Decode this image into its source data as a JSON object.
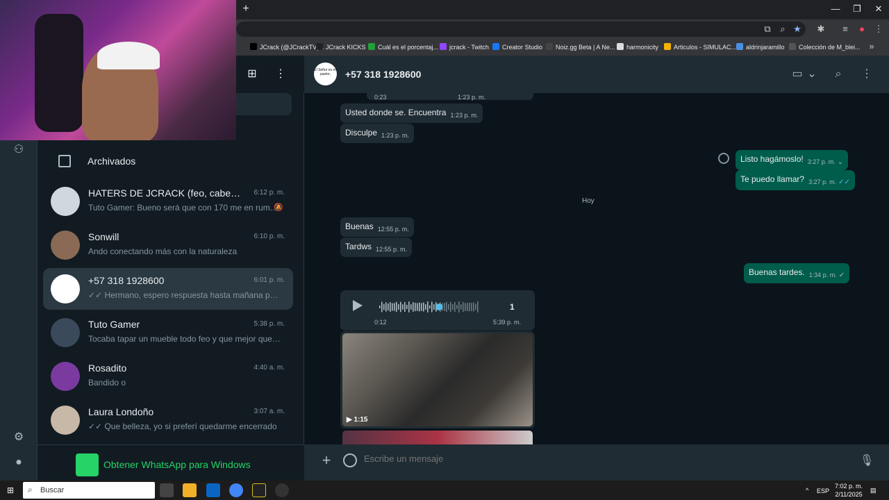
{
  "browser": {
    "new_tab_symbol": "+",
    "bookmarks": [
      {
        "label": "JCrack (@JCrackTV)...",
        "color": "#000000"
      },
      {
        "label": "JCrack KICKS",
        "color": "#222222"
      },
      {
        "label": "Cuál es el porcentaj...",
        "color": "#21a038"
      },
      {
        "label": "jcrack - Twitch",
        "color": "#9146ff"
      },
      {
        "label": "Creator Studio",
        "color": "#1877f2"
      },
      {
        "label": "Noiz.gg Beta | A Ne...",
        "color": "#444444"
      },
      {
        "label": "harmonicity",
        "color": "#dddddd"
      },
      {
        "label": "Articulos - SIMULAC...",
        "color": "#f4b400"
      },
      {
        "label": "aldrinjaramillo",
        "color": "#4a90e2"
      },
      {
        "label": "Colección de M_blei...",
        "color": "#555555"
      }
    ]
  },
  "sidebar": {
    "archived_label": "Archivados",
    "promo_label": "Obtener WhatsApp para Windows",
    "chats": [
      {
        "name": "HATERS DE JCRACK (feo, cabeza de ...",
        "time": "6:12 p. m.",
        "preview": "Tuto Gamer: Bueno será que con 170 me en rum...",
        "muted": true,
        "avatar_color": "#cfd8dc"
      },
      {
        "name": "Sonwill",
        "time": "6:10 p. m.",
        "preview": "Ando conectando más con la naturaleza",
        "muted": false,
        "avatar_color": "#8a6a55"
      },
      {
        "name": "+57 318 1928600",
        "time": "6:01 p. m.",
        "preview": "✓✓ Hermano, espero respuesta hasta mañana para ...",
        "muted": false,
        "avatar_color": "#ffffff"
      },
      {
        "name": "Tuto Gamer",
        "time": "5:38 p. m.",
        "preview": "Tocaba tapar un mueble todo feo y que mejor que e...",
        "muted": false,
        "avatar_color": "#3a4a5a"
      },
      {
        "name": "Rosadito",
        "time": "4:40 a. m.",
        "preview": "Bandido o",
        "muted": false,
        "avatar_color": "#7a3aa0"
      },
      {
        "name": "Laura Londoño",
        "time": "3:07 a. m.",
        "preview": "✓✓ Que belleza, yo si preferí quedarme encerrado",
        "muted": false,
        "avatar_color": "#c8b8a8"
      }
    ]
  },
  "chat": {
    "title": "+57 318 1928600",
    "header_avatar_text": "El Señor es mi pastor,",
    "day_chip": "Hoy",
    "top_partial": {
      "duration": "0:23",
      "time": "1:23 p. m."
    },
    "messages": [
      {
        "text": "Usted donde se. Encuentra",
        "time": "1:23 p. m."
      },
      {
        "text": "Disculpe",
        "time": "1:23 p. m."
      },
      {
        "text": "Listo hagámoslo!",
        "time": "3:27 p. m."
      },
      {
        "text": "Te puedo llamar?",
        "time": "3:27 p. m."
      },
      {
        "text": "Buenas",
        "time": "12:55 p. m."
      },
      {
        "text": "Tardws",
        "time": "12:55 p. m."
      },
      {
        "text": "Buenas tardes.",
        "time": "1:34 p. m."
      }
    ],
    "voice": {
      "count": "1",
      "duration": "0:12",
      "time": "5:39 p. m.",
      "progress": 0.6
    },
    "video": {
      "duration": "1:15"
    },
    "composer_placeholder": "Escribe un mensaje"
  },
  "taskbar": {
    "search_label": "Buscar",
    "lang": "ESP",
    "time": "7:02 p. m.",
    "date": "2/11/2025"
  }
}
